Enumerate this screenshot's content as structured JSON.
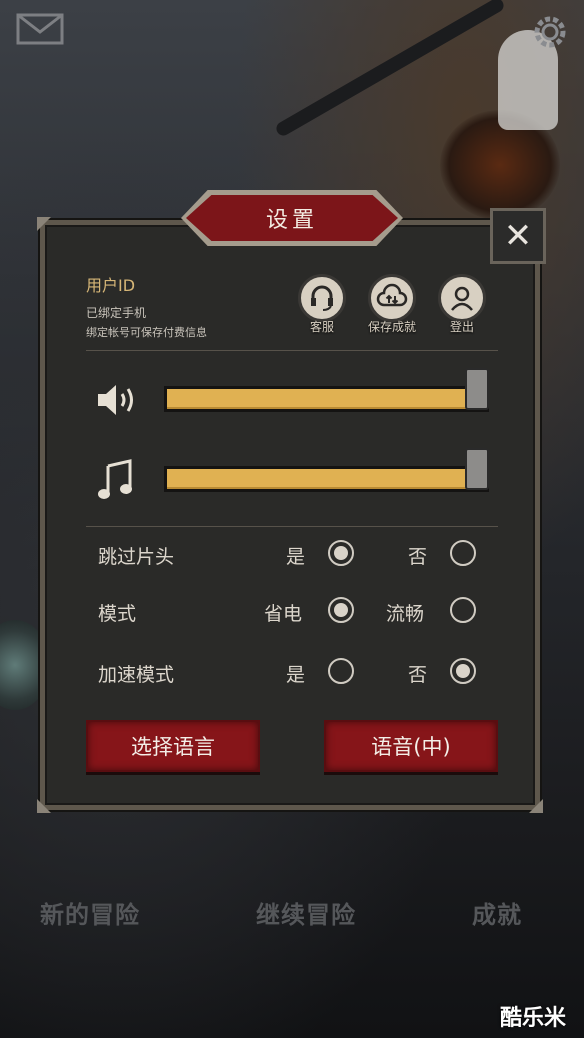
{
  "title": "设置",
  "close_label": "✕",
  "account": {
    "user_id_label": "用户ID",
    "bound_text": "已绑定手机",
    "hint_text": "绑定帐号可保存付费信息"
  },
  "round_buttons": [
    {
      "label": "客服",
      "icon": "headset-icon"
    },
    {
      "label": "保存成就",
      "icon": "cloud-sync-icon"
    },
    {
      "label": "登出",
      "icon": "avatar-icon"
    }
  ],
  "sliders": [
    {
      "name": "sound",
      "icon": "speaker-icon",
      "value": 1.0
    },
    {
      "name": "music",
      "icon": "music-note-icon",
      "value": 1.0
    }
  ],
  "options": [
    {
      "label": "跳过片头",
      "choices": [
        {
          "label": "是",
          "selected": true
        },
        {
          "label": "否",
          "selected": false
        }
      ]
    },
    {
      "label": "模式",
      "choices": [
        {
          "label": "省电",
          "selected": true
        },
        {
          "label": "流畅",
          "selected": false
        }
      ]
    },
    {
      "label": "加速模式",
      "choices": [
        {
          "label": "是",
          "selected": false
        },
        {
          "label": "否",
          "selected": true
        }
      ]
    }
  ],
  "buttons": {
    "select_language": "选择语言",
    "voice": "语音(中)"
  },
  "bottom_menu": {
    "new_adventure": "新的冒险",
    "continue_adventure": "继续冒险",
    "achievements": "成就"
  },
  "watermark": "酷乐米",
  "colors": {
    "accent_red": "#861519",
    "slider_fill": "#e0b152",
    "uid_gold": "#d6b677"
  }
}
